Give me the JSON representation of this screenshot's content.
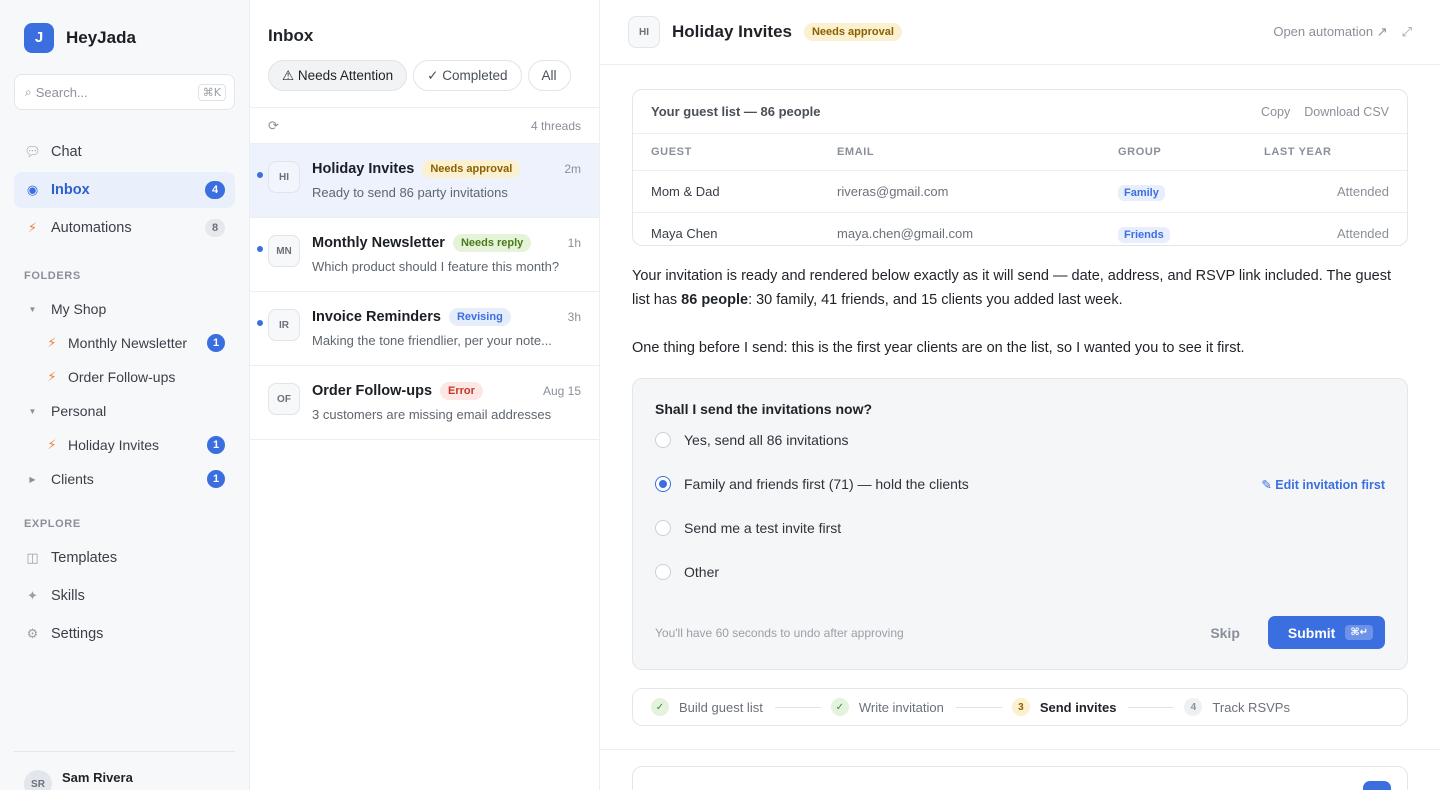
{
  "brand": {
    "logo_letter": "J",
    "name": "HeyJada"
  },
  "search": {
    "placeholder": "Search...",
    "shortcut": "⌘K"
  },
  "nav": [
    {
      "label": "Chat",
      "icon": "chat-bubble-icon",
      "badge": ""
    },
    {
      "label": "Inbox",
      "icon": "inbox-icon",
      "badge": "4"
    },
    {
      "label": "Automations",
      "icon": "bolt-icon",
      "badge": "8"
    }
  ],
  "folders": {
    "title": "FOLDERS",
    "my_shop": "My Shop",
    "monthly_newsletter": {
      "label": "Monthly Newsletter",
      "badge": "1"
    },
    "order_followups": "Order Follow-ups",
    "personal": "Personal",
    "holiday_invites": {
      "label": "Holiday Invites",
      "badge": "1"
    },
    "clients": {
      "label": "Clients",
      "badge": "1"
    }
  },
  "explore": {
    "title": "EXPLORE",
    "templates": "Templates",
    "skills": "Skills",
    "settings": "Settings"
  },
  "user": {
    "name": "Sam Rivera",
    "initials": "SR"
  },
  "inbox": {
    "title": "Inbox",
    "filters": [
      "⚠ Needs Attention",
      "✓ Completed",
      "All"
    ],
    "thread_count": "4 threads",
    "threads": [
      {
        "initials": "HI",
        "name": "Holiday Invites",
        "status": "Needs approval",
        "time": "2m",
        "preview": "Ready to send 86 party invitations"
      },
      {
        "initials": "MN",
        "name": "Monthly Newsletter",
        "status": "Needs reply",
        "time": "1h",
        "preview": "Which product should I feature this month?"
      },
      {
        "initials": "IR",
        "name": "Invoice Reminders",
        "status": "Revising",
        "time": "3h",
        "preview": "Making the tone friendlier, per your note..."
      },
      {
        "initials": "OF",
        "name": "Order Follow-ups",
        "status": "Error",
        "time": "Aug 15",
        "preview": "3 customers are missing email addresses"
      }
    ]
  },
  "header": {
    "initials": "HI",
    "title": "Holiday Invites",
    "status": "Needs approval",
    "open_automation": "Open automation ↗",
    "expand": "⤢"
  },
  "guest_list": {
    "title": "Your guest list — 86 people",
    "copy": "Copy",
    "download": "Download CSV",
    "columns": [
      "GUEST",
      "EMAIL",
      "GROUP",
      "LAST YEAR"
    ],
    "rows": [
      {
        "guest": "Mom & Dad",
        "email": "riveras@gmail.com",
        "group": "Family",
        "last_year": "Attended"
      },
      {
        "guest": "Maya Chen",
        "email": "maya.chen@gmail.com",
        "group": "Friends",
        "last_year": "Attended"
      }
    ]
  },
  "message": {
    "p1_before": "Your invitation is ready and rendered below exactly as it will send — date, address, and RSVP link included. The guest list has ",
    "p1_bold": "86 people",
    "p1_after": ": 30 family, 41 friends, and 15 clients you added last week.",
    "p2": "One thing before I send: this is the first year clients are on the list, so I wanted you to see it first."
  },
  "question": {
    "title": "Shall I send the invitations now?",
    "options": [
      "Yes, send all 86 invitations",
      "Family and friends first (71) — hold the clients",
      "Send me a test invite first",
      "Other"
    ],
    "selected_index": 1,
    "edit_link": "✎ Edit invitation first",
    "undo_note": "You'll have 60 seconds to undo after approving",
    "skip": "Skip",
    "submit": "Submit",
    "submit_shortcut": "⌘↵"
  },
  "steps": [
    {
      "mark": "✓",
      "label": "Build guest list",
      "state": "done"
    },
    {
      "mark": "✓",
      "label": "Write invitation",
      "state": "done"
    },
    {
      "mark": "3",
      "label": "Send invites",
      "state": "current"
    },
    {
      "mark": "4",
      "label": "Track RSVPs",
      "state": "todo"
    }
  ],
  "composer": {
    "send_icon": "↑"
  },
  "colors": {
    "accent": "#3b6fe0",
    "amber_bg": "#fbf0cf",
    "sidebar_bg": "#f7f8fa"
  }
}
